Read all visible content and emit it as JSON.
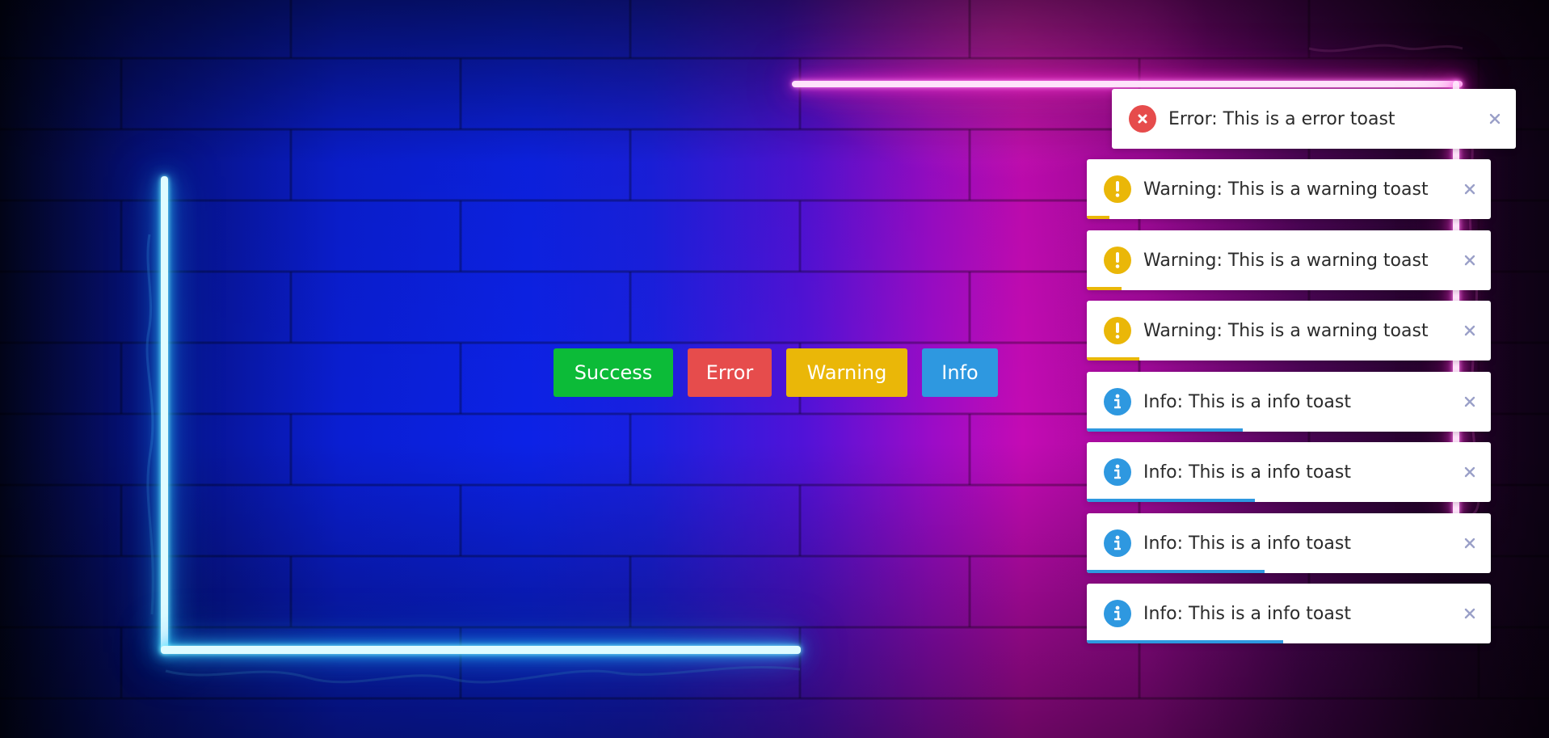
{
  "colors": {
    "success": "#0cbb38",
    "error": "#e64c4c",
    "warning": "#eab708",
    "info": "#2e98e0",
    "close_icon": "#9aa0c8",
    "toast_text": "#2b2b2b"
  },
  "buttons": [
    {
      "label": "Success",
      "type": "success"
    },
    {
      "label": "Error",
      "type": "error"
    },
    {
      "label": "Warning",
      "type": "warning"
    },
    {
      "label": "Info",
      "type": "info"
    }
  ],
  "toasts": [
    {
      "type": "error",
      "icon": "error-x-icon",
      "message": "Error: This is a error toast",
      "progress": 0
    },
    {
      "type": "warning",
      "icon": "warning-exclamation-icon",
      "message": "Warning: This is a warning toast",
      "progress": 0.055
    },
    {
      "type": "warning",
      "icon": "warning-exclamation-icon",
      "message": "Warning: This is a warning toast",
      "progress": 0.085
    },
    {
      "type": "warning",
      "icon": "warning-exclamation-icon",
      "message": "Warning: This is a warning toast",
      "progress": 0.13
    },
    {
      "type": "info",
      "icon": "info-icon",
      "message": "Info: This is a info toast",
      "progress": 0.385
    },
    {
      "type": "info",
      "icon": "info-icon",
      "message": "Info: This is a info toast",
      "progress": 0.415
    },
    {
      "type": "info",
      "icon": "info-icon",
      "message": "Info: This is a info toast",
      "progress": 0.44
    },
    {
      "type": "info",
      "icon": "info-icon",
      "message": "Info: This is a info toast",
      "progress": 0.485
    }
  ]
}
